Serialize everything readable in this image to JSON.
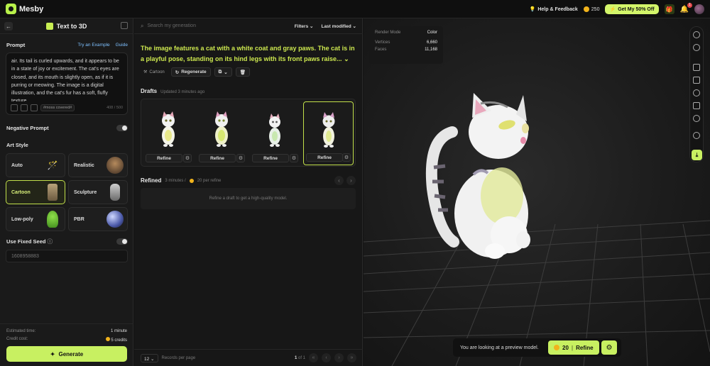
{
  "app": {
    "name": "Mesby"
  },
  "topbar": {
    "help_label": "Help & Feedback",
    "credits": "250",
    "promo_label": "Get My 50% Off",
    "notifications": "1"
  },
  "left": {
    "title": "Text to 3D",
    "prompt_label": "Prompt",
    "try_example": "Try an Example",
    "guide": "Guide",
    "prompt_text": "air. Its tail is curled upwards, and it appears to be in a state of joy or excitement. The cat's eyes are closed, and its mouth is slightly open, as if it is purring or meowing. The image is a digital illustration, and the cat's fur has a soft, fluffy texture.",
    "prompt_tag": "#moss covered#",
    "prompt_count": "408 / 500",
    "negative_prompt": "Negative Prompt",
    "art_style": "Art Style",
    "styles": [
      {
        "label": "Auto",
        "color": "#3a2a2a"
      },
      {
        "label": "Realistic",
        "color": "#6b4a30"
      },
      {
        "label": "Cartoon",
        "color": "#8a7a60"
      },
      {
        "label": "Sculpture",
        "color": "#9a9a9a"
      },
      {
        "label": "Low-poly",
        "color": "#7ecb3c"
      },
      {
        "label": "PBR",
        "color": "#7080c0"
      }
    ],
    "selected_style": "Cartoon",
    "fixed_seed": "Use Fixed Seed",
    "seed_value": "1608958883",
    "estimated_label": "Estimated time:",
    "estimated_value": "1 minute",
    "cost_label": "Credit cost:",
    "cost_value": "5 credits",
    "generate": "Generate"
  },
  "middle": {
    "search_placeholder": "Search my generation",
    "filters": "Filters",
    "sort": "Last modified",
    "description": "The image features a cat with a white coat and gray paws. The cat is in a playful pose, standing on its hind legs with its front paws raise...",
    "style_chip": "Cartoon",
    "regenerate": "Regenerate",
    "drafts_title": "Drafts",
    "drafts_updated": "Updated 3 minutes ago",
    "refine_label": "Refine",
    "refined_title": "Refined",
    "refined_time": "3 minutes /",
    "refined_cost": "20 per refine",
    "refined_empty": "Refine a draft to get a high-quality model.",
    "page_size": "12",
    "records_per_page": "Records per page",
    "page_current": "1",
    "page_total": "of 1"
  },
  "viewport": {
    "render_mode_label": "Render Mode",
    "render_mode_value": "Color",
    "vertices_label": "Vertices",
    "vertices_value": "6,660",
    "faces_label": "Faces",
    "faces_value": "11,168",
    "preview_text": "You are looking at a preview model.",
    "refine_cost": "20",
    "refine_label": "Refine"
  },
  "colors": {
    "accent": "#c8f061",
    "highlight": "#cde84f"
  }
}
